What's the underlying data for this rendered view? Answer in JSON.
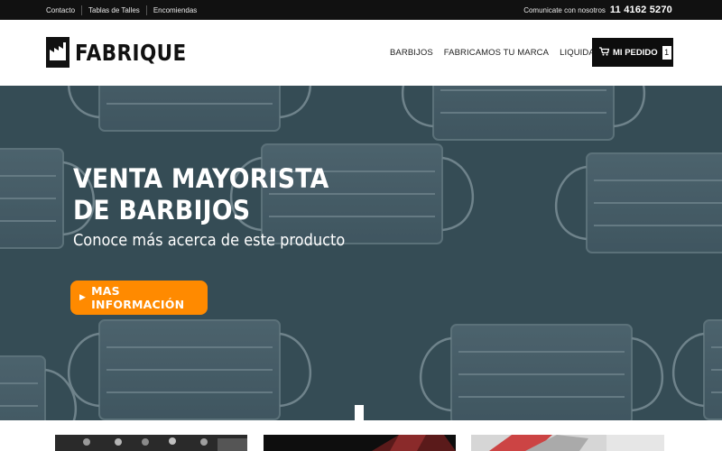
{
  "topbar": {
    "links": [
      "Contacto",
      "Tablas de Talles",
      "Encomiendas"
    ],
    "phone_label": "Comunicate con nosotros",
    "phone_number": "11 4162 5270"
  },
  "header": {
    "brand": "FABRIQUE",
    "nav": [
      "BARBIJOS",
      "FABRICAMOS TU MARCA",
      "LIQUIDACION"
    ],
    "cart_label": "MI PEDIDO",
    "cart_count": "1"
  },
  "hero": {
    "title_line1": "VENTA MAYORISTA",
    "title_line2": "DE BARBIJOS",
    "subtitle": "Conoce más acerca de este producto",
    "button_label": "MAS INFORMACIÓN",
    "accent_color": "#ff8a00"
  },
  "icons": {
    "cart": "cart-icon",
    "play": "play-icon",
    "logo": "factory-icon"
  }
}
